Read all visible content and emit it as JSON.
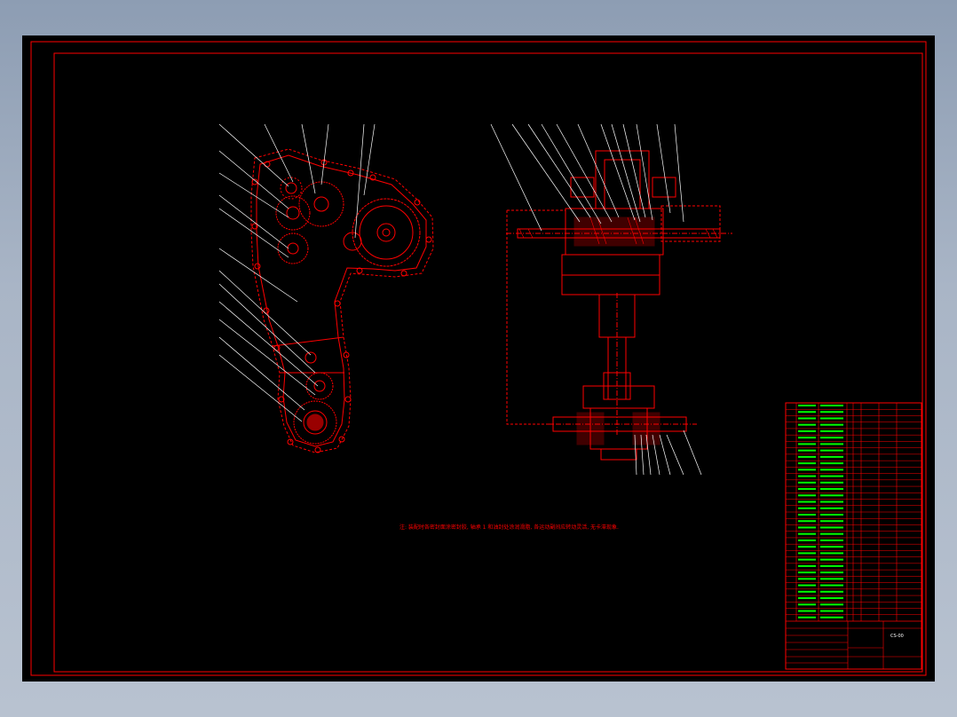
{
  "drawing": {
    "technical_note": "注: 装配时各密封面涂密封胶, 轴承 1 和油封处涂润滑脂, 各运动副间应转动灵活, 无卡滞现象.",
    "colors": {
      "background": "#000000",
      "outline": "#ff0000",
      "text": "#00ff00",
      "frame": "#ff0000",
      "viewport_bg": "#8d9db3"
    }
  },
  "title_block": {
    "drawing_code": "CS-00",
    "bom_row_count": 34
  }
}
